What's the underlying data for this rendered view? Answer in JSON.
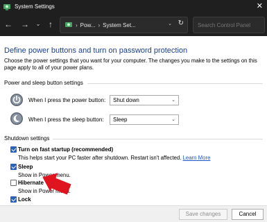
{
  "window": {
    "title": "System Settings",
    "close_glyph": "✕"
  },
  "nav": {
    "back_glyph": "←",
    "forward_glyph": "→",
    "dropdown_glyph": "⌄",
    "up_glyph": "↑",
    "breadcrumb": [
      "Pow...",
      "System Set..."
    ],
    "breadcrumb_sep": "›",
    "address_dropdown_glyph": "⌄",
    "refresh_glyph": "↻",
    "search_placeholder": "Search Control Panel"
  },
  "page": {
    "heading": "Define power buttons and turn on password protection",
    "intro": "Choose the power settings that you want for your computer. The changes you make to the settings on this page apply to all of your power plans."
  },
  "power_buttons": {
    "group_label": "Power and sleep button settings",
    "power_label": "When I press the power button:",
    "power_value": "Shut down",
    "sleep_label": "When I press the sleep button:",
    "sleep_value": "Sleep",
    "chevron": "⌄"
  },
  "shutdown": {
    "group_label": "Shutdown settings",
    "fast_startup": {
      "label": "Turn on fast startup (recommended)",
      "desc": "This helps start your PC faster after shutdown. Restart isn't affected.",
      "link": "Learn More",
      "checked": true
    },
    "sleep": {
      "label": "Sleep",
      "desc": "Show in Power menu.",
      "checked": true
    },
    "hibernate": {
      "label": "Hibernate",
      "desc": "Show in Power menu.",
      "checked": false
    },
    "lock": {
      "label": "Lock",
      "checked": true
    }
  },
  "footer": {
    "save_label": "Save changes",
    "cancel_label": "Cancel"
  },
  "colors": {
    "accent": "#2b63b6",
    "heading": "#1a3e8c",
    "arrow": "#e0141e",
    "titlebar": "#1f1f1f"
  }
}
